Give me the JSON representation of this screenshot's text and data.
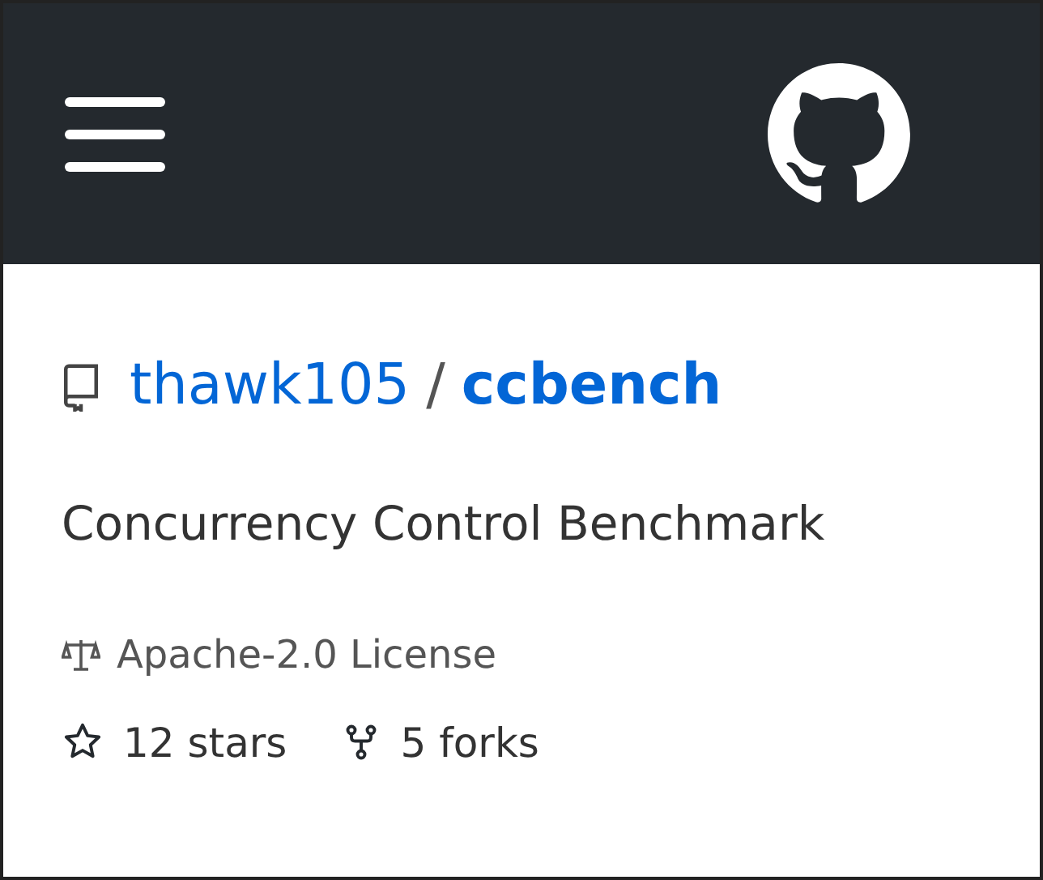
{
  "repo": {
    "owner": "thawk105",
    "separator": "/",
    "name": "ccbench"
  },
  "description": "Concurrency Control Benchmark",
  "license": "Apache-2.0 License",
  "stats": [
    {
      "kind": "stars",
      "text": "12 stars"
    },
    {
      "kind": "forks",
      "text": "5 forks"
    }
  ]
}
